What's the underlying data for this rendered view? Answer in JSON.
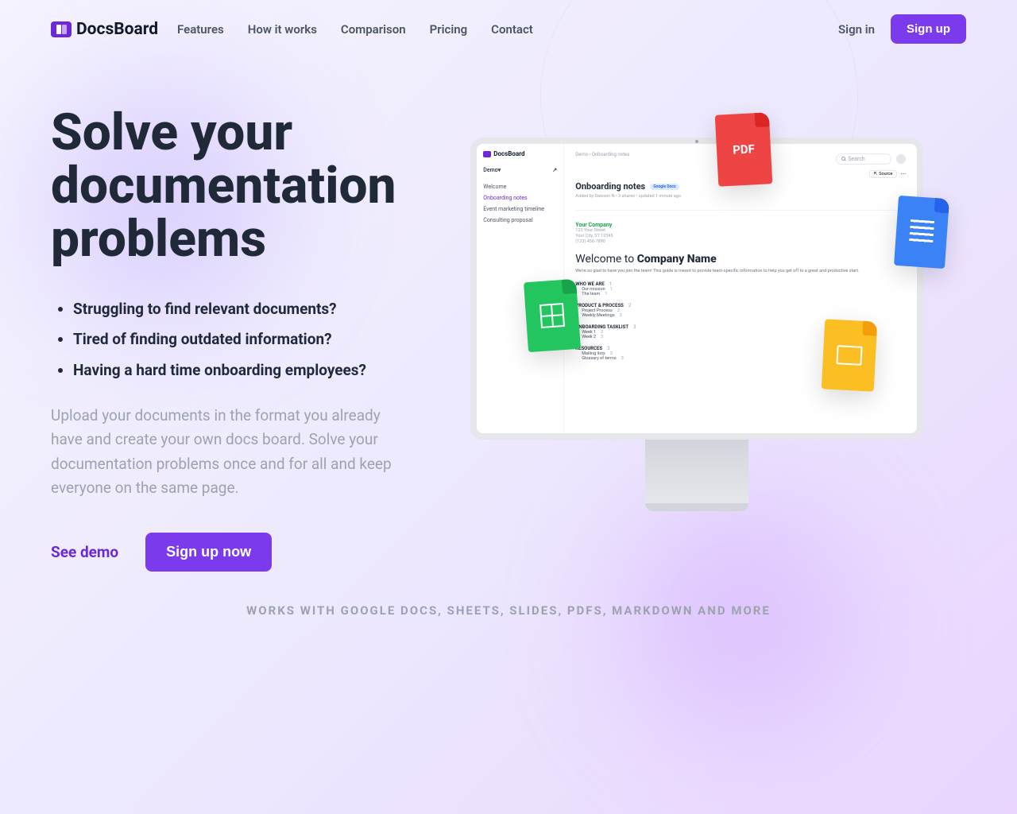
{
  "brand": "DocsBoard",
  "nav": {
    "links": [
      "Features",
      "How it works",
      "Comparison",
      "Pricing",
      "Contact"
    ],
    "signin": "Sign in",
    "signup": "Sign up"
  },
  "hero": {
    "title": "Solve your documentation problems",
    "bullets": [
      "Struggling to find relevant documents?",
      "Tired of finding outdated information?",
      "Having a hard time onboarding employees?"
    ],
    "desc": "Upload your documents in the format you already have and create your own docs board. Solve your documentation problems once and for all and keep everyone on the same page.",
    "demo": "See demo",
    "cta": "Sign up now"
  },
  "app": {
    "brand": "DocsBoard",
    "workspace": "Demo",
    "breadcrumb": "Demo › Onboarding notes",
    "sidebar": [
      "Welcome",
      "Onboarding notes",
      "Event marketing timeline",
      "Consulting proposal"
    ],
    "active_index": 1,
    "search_placeholder": "Search",
    "source_btn": "Source",
    "doc": {
      "title": "Onboarding notes",
      "badge": "Google Docs",
      "meta": "Added by Dawson N • 3 shares • updated 1 minute ago",
      "company": "Your Company",
      "addr1": "123 Your Street",
      "addr2": "Your City, ST 12345",
      "addr3": "(123) 456-7890",
      "welcome_pre": "Welcome to ",
      "welcome_bold": "Company Name",
      "intro": "We're so glad to have you join the team! This guide is meant to provide team-specific information to help you get off to a great and productive start.",
      "sections": [
        {
          "h": "WHO WE ARE",
          "n": "1",
          "items": [
            [
              "Our mission",
              "1"
            ],
            [
              "The team",
              "1"
            ]
          ]
        },
        {
          "h": "PRODUCT & PROCESS",
          "n": "2",
          "items": [
            [
              "Project Process",
              "2"
            ],
            [
              "Weekly Meetings",
              "2"
            ]
          ]
        },
        {
          "h": "ONBOARDING TASKLIST",
          "n": "3",
          "items": [
            [
              "Week 1",
              "2"
            ],
            [
              "Week 2",
              "3"
            ]
          ]
        },
        {
          "h": "RESOURCES",
          "n": "3",
          "items": [
            [
              "Mailing lists",
              "3"
            ],
            [
              "Glossary of terms",
              "3"
            ]
          ]
        }
      ]
    }
  },
  "icons": {
    "pdf": "PDF"
  },
  "works": "WORKS WITH GOOGLE DOCS, SHEETS, SLIDES, PDFS, MARKDOWN AND MORE"
}
